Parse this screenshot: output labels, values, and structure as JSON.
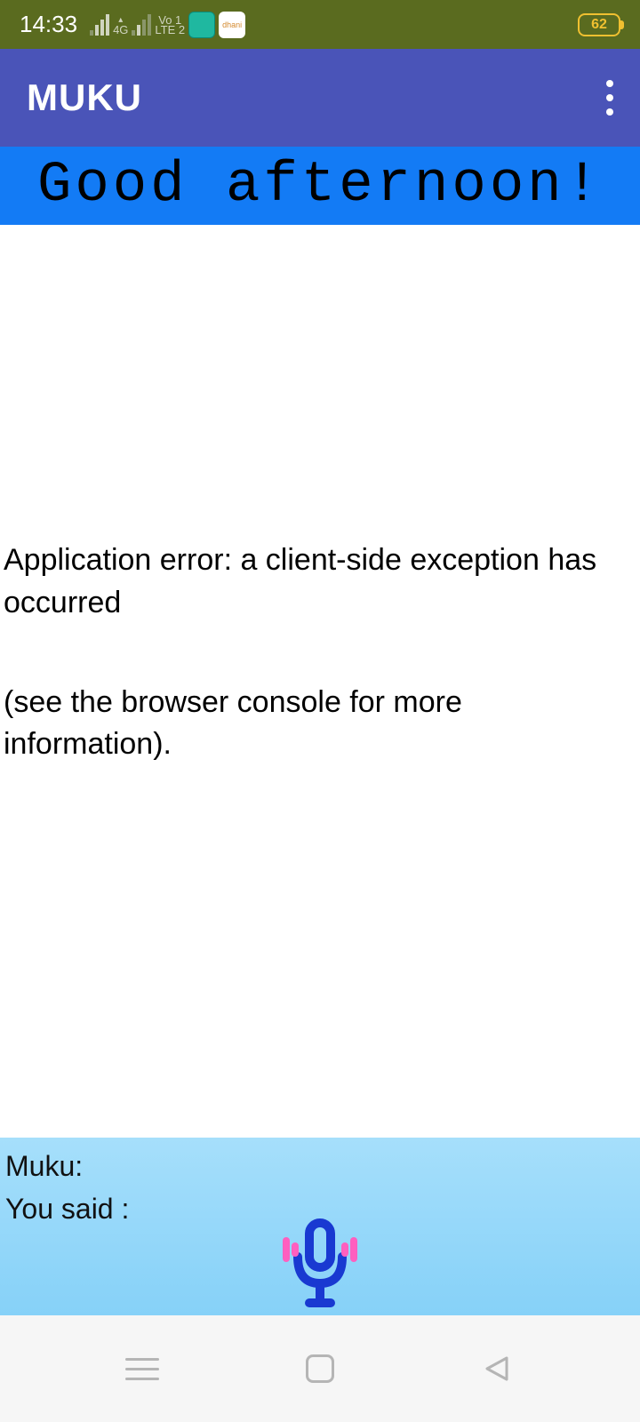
{
  "status": {
    "time": "14:33",
    "net1": "4G",
    "net2_top": "Vo 1",
    "net2_bot": "LTE 2",
    "battery": "62"
  },
  "appbar": {
    "title": "MUKU"
  },
  "greeting": {
    "text": "Good afternoon!"
  },
  "error": {
    "line1": "Application error: a client-side exception has occurred",
    "line2": "(see the browser console for more information)."
  },
  "voice": {
    "muku_label": "Muku:",
    "yousaid_label": "You said :"
  }
}
